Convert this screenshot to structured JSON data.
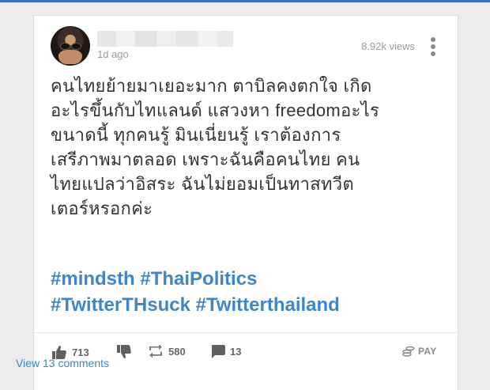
{
  "post": {
    "time": "1d ago",
    "views": "8.92k views",
    "text_lines": [
      "คนไทยย้ายมาเยอะมาก ตาบิลคงตกใจ เกิด",
      "อะไรขึ้นกับไทแลนด์ แสวงหา freedomอะไร",
      "ขนาดนี้ ทุกคนรู้ มินเนี่ยนรู้ เราต้องการ",
      "เสรีภาพมาตลอด เพราะฉันคือคนไทย คน",
      "ไทยแปลว่าอิสระ ฉันไม่ยอมเป็นทาสทวีต",
      "เตอร์หรอกค่ะ"
    ],
    "hashtag_lines": [
      "#mindsth #ThaiPolitics",
      "#TwitterTHsuck #Twitterthailand"
    ]
  },
  "actions": {
    "likes": "713",
    "reposts": "580",
    "comments": "13",
    "pay_label": "PAY"
  },
  "footer": {
    "view_comments": "View 13 comments"
  },
  "colors": {
    "accent": "#3b73c2",
    "link": "#3f86c7",
    "text": "#333333",
    "muted": "#9a9a9a"
  }
}
